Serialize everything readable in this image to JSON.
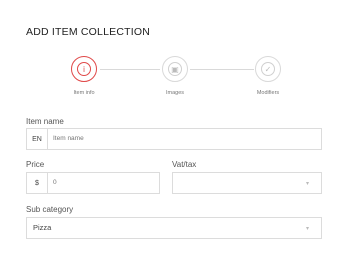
{
  "header": {
    "title": "ADD ITEM COLLECTION"
  },
  "stepper": {
    "steps": [
      {
        "label": "Item info",
        "icon": "info-icon",
        "glyph": "i",
        "active": true
      },
      {
        "label": "Images",
        "icon": "image-icon",
        "glyph": "▣",
        "active": false
      },
      {
        "label": "Modifiers",
        "icon": "check-icon",
        "glyph": "✓",
        "active": false
      }
    ]
  },
  "form": {
    "item_name": {
      "label": "Item name",
      "prefix": "EN",
      "placeholder": "Item name"
    },
    "price": {
      "label": "Price",
      "prefix": "$",
      "placeholder": "0"
    },
    "vat": {
      "label": "Vat/tax",
      "value": ""
    },
    "sub_category": {
      "label": "Sub category",
      "value": "Pizza"
    }
  },
  "colors": {
    "accent": "#e04848",
    "border": "#dcdcdc"
  }
}
